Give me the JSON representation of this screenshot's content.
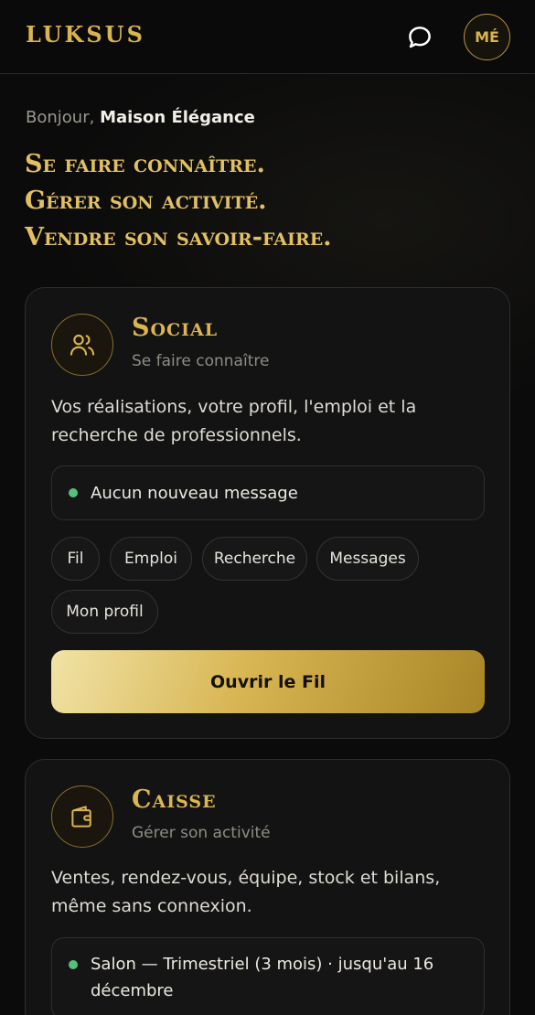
{
  "app": {
    "brand": "LUKSUS",
    "avatar_initials": "MÉ"
  },
  "header": {
    "chat_icon": "chat-bubble-icon"
  },
  "greeting": {
    "prefix": "Bonjour,",
    "name": "Maison Élégance"
  },
  "tagline": [
    "Se faire connaître.",
    "Gérer son activité.",
    "Vendre son savoir-faire."
  ],
  "cards": [
    {
      "icon": "users-icon",
      "title": "Social",
      "subtitle": "Se faire connaître",
      "description": "Vos réalisations, votre profil, l'emploi et la recherche de professionnels.",
      "status": "Aucun nouveau message",
      "chips": [
        "Fil",
        "Emploi",
        "Recherche",
        "Messages",
        "Mon profil"
      ],
      "cta": "Ouvrir le Fil"
    },
    {
      "icon": "wallet-icon",
      "title": "Caisse",
      "subtitle": "Gérer son activité",
      "description": "Ventes, rendez-vous, équipe, stock et bilans, même sans connexion.",
      "status": "Salon — Trimestriel (3 mois) · jusqu'au 16 décembre"
    }
  ],
  "colors": {
    "gold": "#d9b34e",
    "background": "#0b0b0b",
    "card": "#131313",
    "status_dot": "#52c27a"
  }
}
